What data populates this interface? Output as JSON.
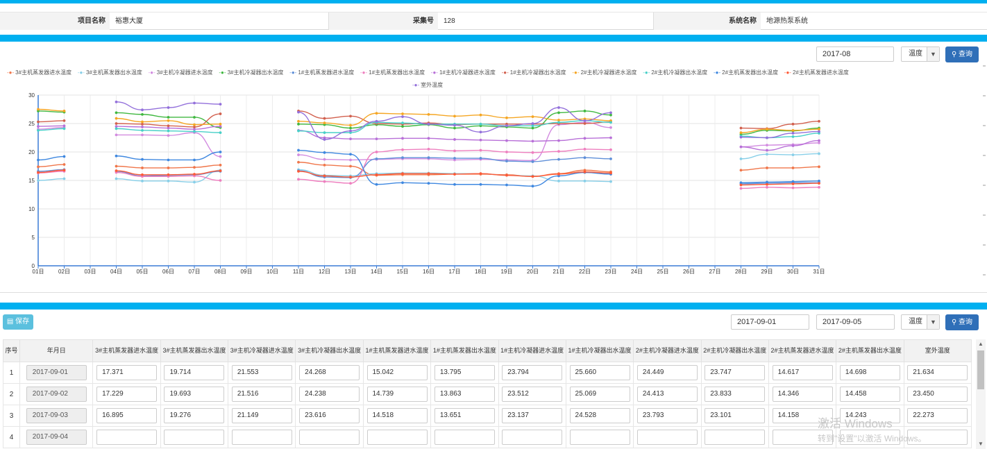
{
  "header": {
    "project_label": "项目名称",
    "project_value": "裕惠大厦",
    "collect_label": "采集号",
    "collect_value": "128",
    "system_label": "系统名称",
    "system_value": "地源热泵系统"
  },
  "chart_controls": {
    "month": "2017-08",
    "metric": "温度",
    "query_label": "查询"
  },
  "chart_data": {
    "type": "line",
    "x": [
      "01日",
      "02日",
      "03日",
      "04日",
      "05日",
      "06日",
      "07日",
      "08日",
      "09日",
      "10日",
      "11日",
      "12日",
      "13日",
      "14日",
      "15日",
      "16日",
      "17日",
      "18日",
      "19日",
      "20日",
      "21日",
      "22日",
      "23日",
      "24日",
      "25日",
      "26日",
      "27日",
      "28日",
      "29日",
      "30日",
      "31日"
    ],
    "ylim": [
      0,
      30
    ],
    "yticks": [
      0,
      5,
      10,
      15,
      20,
      25,
      30
    ],
    "grid": true,
    "legend_position": "top",
    "series": [
      {
        "name": "3#主机蒸发器进水温度",
        "color": "#f0764a",
        "values": [
          17.4,
          17.8,
          null,
          17.5,
          17.2,
          17.2,
          17.3,
          17.7,
          null,
          null,
          18.2,
          17.7,
          17.5,
          15.9,
          16.0,
          16.0,
          16.1,
          16.1,
          16.0,
          15.7,
          16.2,
          16.8,
          16.5,
          null,
          null,
          null,
          null,
          16.8,
          17.2,
          17.2,
          17.4
        ]
      },
      {
        "name": "3#主机蒸发器出水温度",
        "color": "#88cfe8",
        "values": [
          15.0,
          15.3,
          null,
          15.3,
          14.9,
          14.9,
          14.7,
          16.8,
          null,
          null,
          16.9,
          15.9,
          15.8,
          16.2,
          16.3,
          16.3,
          16.2,
          16.2,
          15.9,
          15.8,
          14.9,
          14.9,
          14.8,
          null,
          null,
          null,
          null,
          18.8,
          19.6,
          19.5,
          19.7
        ]
      },
      {
        "name": "3#主机冷凝器进水温度",
        "color": "#d28be0",
        "values": [
          24.0,
          24.3,
          null,
          23.0,
          23.0,
          22.9,
          23.4,
          19.2,
          null,
          null,
          19.5,
          18.7,
          18.6,
          18.7,
          18.8,
          18.8,
          18.6,
          18.7,
          18.6,
          18.5,
          24.8,
          25.2,
          24.3,
          null,
          null,
          null,
          null,
          20.9,
          21.2,
          21.3,
          21.6
        ]
      },
      {
        "name": "3#主机冷凝器出水温度",
        "color": "#40b840",
        "values": [
          27.2,
          27.0,
          null,
          26.9,
          26.6,
          26.1,
          26.1,
          24.3,
          null,
          null,
          24.9,
          24.8,
          24.2,
          24.8,
          24.5,
          24.8,
          24.2,
          24.6,
          24.4,
          24.2,
          26.9,
          27.2,
          26.5,
          null,
          null,
          null,
          null,
          23.1,
          23.8,
          23.7,
          24.2
        ]
      },
      {
        "name": "1#主机蒸发器进水温度",
        "color": "#5f8fd8",
        "values": [
          16.6,
          16.9,
          null,
          16.6,
          15.8,
          15.9,
          16.0,
          16.6,
          null,
          null,
          16.7,
          15.6,
          15.5,
          18.8,
          19.0,
          19.0,
          18.9,
          18.9,
          18.4,
          18.3,
          18.7,
          19.0,
          18.8,
          null,
          null,
          null,
          null,
          14.4,
          14.5,
          14.6,
          14.6
        ]
      },
      {
        "name": "1#主机蒸发器出水温度",
        "color": "#ee7fbf",
        "values": [
          16.3,
          16.6,
          null,
          16.4,
          15.7,
          15.7,
          15.8,
          15.0,
          null,
          null,
          15.2,
          14.8,
          14.5,
          20.0,
          20.4,
          20.5,
          20.2,
          20.3,
          20.0,
          19.9,
          20.1,
          20.5,
          20.4,
          null,
          null,
          null,
          null,
          13.6,
          13.8,
          13.7,
          13.8
        ]
      },
      {
        "name": "1#主机冷凝器进水温度",
        "color": "#b870d8",
        "values": [
          24.5,
          24.6,
          null,
          24.5,
          24.4,
          24.2,
          24.0,
          24.5,
          null,
          null,
          23.8,
          22.5,
          22.3,
          22.3,
          22.4,
          22.4,
          22.2,
          22.1,
          22.0,
          21.9,
          22.0,
          22.4,
          22.5,
          null,
          null,
          null,
          null,
          20.9,
          20.3,
          21.1,
          22.0
        ]
      },
      {
        "name": "1#主机冷凝器出水温度",
        "color": "#d2604e",
        "values": [
          25.3,
          25.5,
          null,
          25.0,
          24.9,
          24.6,
          24.4,
          26.7,
          null,
          null,
          27.2,
          25.9,
          26.3,
          25.0,
          24.9,
          25.1,
          24.8,
          24.9,
          24.9,
          24.9,
          25.0,
          25.0,
          25.3,
          null,
          null,
          null,
          null,
          24.2,
          24.1,
          24.9,
          25.4
        ]
      },
      {
        "name": "2#主机冷凝器进水温度",
        "color": "#f5a623",
        "values": [
          27.5,
          27.2,
          null,
          25.9,
          25.3,
          25.5,
          24.8,
          24.9,
          null,
          null,
          25.4,
          25.1,
          24.7,
          26.8,
          26.7,
          26.6,
          26.3,
          26.5,
          26.0,
          26.2,
          25.6,
          25.8,
          25.5,
          null,
          null,
          null,
          null,
          23.4,
          24.0,
          23.8,
          24.0
        ]
      },
      {
        "name": "2#主机冷凝器出水温度",
        "color": "#48d0c8",
        "values": [
          23.8,
          24.1,
          null,
          24.1,
          23.8,
          23.7,
          23.6,
          23.4,
          null,
          null,
          23.7,
          23.4,
          23.4,
          25.2,
          25.1,
          24.9,
          24.9,
          24.9,
          24.6,
          24.6,
          25.2,
          25.5,
          25.2,
          null,
          null,
          null,
          null,
          22.8,
          22.5,
          22.7,
          23.3
        ]
      },
      {
        "name": "2#主机蒸发器出水温度",
        "color": "#3f88e0",
        "values": [
          18.6,
          19.2,
          null,
          19.3,
          18.7,
          18.6,
          18.6,
          20.0,
          null,
          null,
          20.3,
          19.9,
          19.6,
          14.3,
          14.6,
          14.5,
          14.3,
          14.3,
          14.2,
          14.0,
          15.8,
          16.4,
          16.1,
          null,
          null,
          null,
          null,
          14.6,
          14.7,
          14.8,
          14.9
        ]
      },
      {
        "name": "2#主机蒸发器进水温度",
        "color": "#ff5a36",
        "values": [
          16.4,
          16.8,
          null,
          16.7,
          16.0,
          16.0,
          16.1,
          16.7,
          null,
          null,
          16.6,
          15.8,
          15.6,
          16.0,
          16.2,
          16.2,
          16.1,
          16.2,
          15.9,
          15.7,
          16.1,
          16.5,
          16.3,
          null,
          null,
          null,
          null,
          14.2,
          14.3,
          14.4,
          14.5
        ]
      },
      {
        "name": "室外温度",
        "color": "#9370db",
        "values": [
          null,
          null,
          null,
          28.8,
          27.4,
          27.8,
          28.6,
          28.4,
          null,
          null,
          27.0,
          22.2,
          23.7,
          25.4,
          26.2,
          24.9,
          24.7,
          23.5,
          24.6,
          25.0,
          27.8,
          25.5,
          26.9,
          null,
          null,
          null,
          null,
          22.6,
          22.5,
          23.3,
          23.6
        ]
      }
    ]
  },
  "table_controls": {
    "save_label": "保存",
    "start_date": "2017-09-01",
    "end_date": "2017-09-05",
    "metric": "温度",
    "query_label": "查询"
  },
  "table": {
    "headers": [
      "序号",
      "年月日",
      "3#主机蒸发器进水温度",
      "3#主机蒸发器出水温度",
      "3#主机冷凝器进水温度",
      "3#主机冷凝器出水温度",
      "1#主机蒸发器进水温度",
      "1#主机蒸发器出水温度",
      "1#主机冷凝器进水温度",
      "1#主机冷凝器出水温度",
      "2#主机冷凝器进水温度",
      "2#主机冷凝器出水温度",
      "2#主机蒸发器进水温度",
      "2#主机蒸发器出水温度",
      "室外温度"
    ],
    "rows": [
      {
        "no": "1",
        "date": "2017-09-01",
        "values": [
          "17.371",
          "19.714",
          "21.553",
          "24.268",
          "15.042",
          "13.795",
          "23.794",
          "25.660",
          "24.449",
          "23.747",
          "14.617",
          "14.698",
          "21.634"
        ]
      },
      {
        "no": "2",
        "date": "2017-09-02",
        "values": [
          "17.229",
          "19.693",
          "21.516",
          "24.238",
          "14.739",
          "13.863",
          "23.512",
          "25.069",
          "24.413",
          "23.833",
          "14.346",
          "14.458",
          "23.450"
        ]
      },
      {
        "no": "3",
        "date": "2017-09-03",
        "values": [
          "16.895",
          "19.276",
          "21.149",
          "23.616",
          "14.518",
          "13.651",
          "23.137",
          "24.528",
          "23.793",
          "23.101",
          "14.158",
          "14.243",
          "22.273"
        ]
      },
      {
        "no": "4",
        "date": "2017-09-04",
        "values": [
          "",
          "",
          "",
          "",
          "",
          "",
          "",
          "",
          "",
          "",
          "",
          "",
          ""
        ]
      }
    ]
  },
  "watermark": {
    "line1": "激活 Windows",
    "line2": "转到\"设置\"以激活 Windows。"
  }
}
